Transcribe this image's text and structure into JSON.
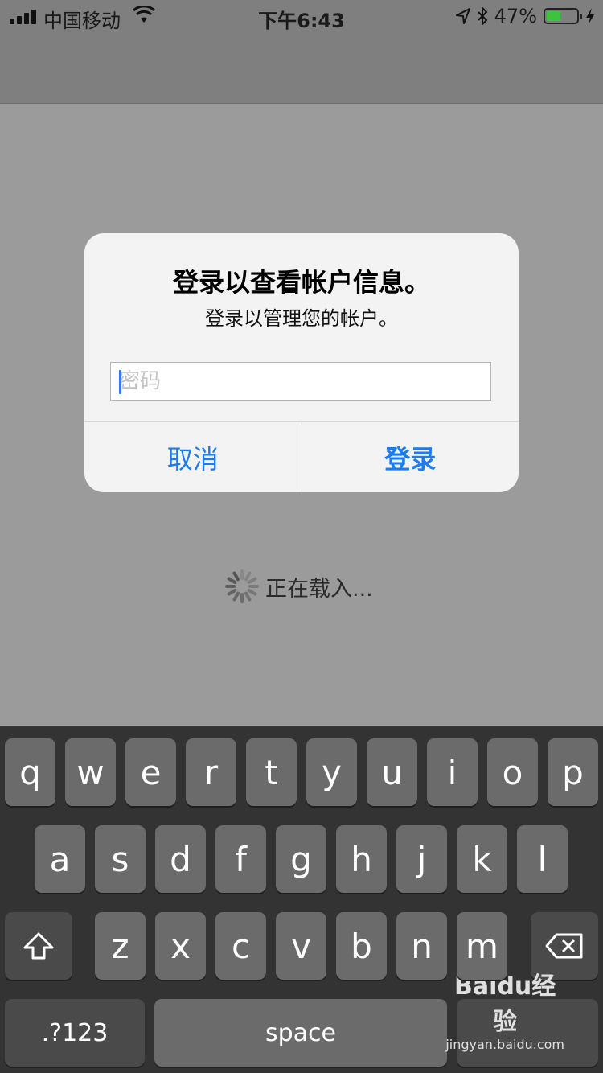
{
  "status_bar": {
    "carrier": "中国移动",
    "time": "下午6:43",
    "battery_percent": "47%",
    "battery_level": 0.47,
    "icons": [
      "signal-icon",
      "wifi-icon",
      "location-icon",
      "bluetooth-icon",
      "battery-icon",
      "charging-icon"
    ]
  },
  "dialog": {
    "title": "登录以查看帐户信息。",
    "message": "登录以管理您的帐户。",
    "password_placeholder": "密码",
    "password_value": "",
    "cancel_label": "取消",
    "login_label": "登录"
  },
  "loading": {
    "text": "正在载入..."
  },
  "keyboard": {
    "row1": [
      "q",
      "w",
      "e",
      "r",
      "t",
      "y",
      "u",
      "i",
      "o",
      "p"
    ],
    "row2": [
      "a",
      "s",
      "d",
      "f",
      "g",
      "h",
      "j",
      "k",
      "l"
    ],
    "row3": [
      "z",
      "x",
      "c",
      "v",
      "b",
      "n",
      "m"
    ],
    "mode_label": ".?123",
    "space_label": "space",
    "shift_icon": "shift-icon",
    "delete_icon": "backspace-icon"
  },
  "watermark": {
    "main": "Baidu经验",
    "sub": "jingyan.baidu.com"
  }
}
